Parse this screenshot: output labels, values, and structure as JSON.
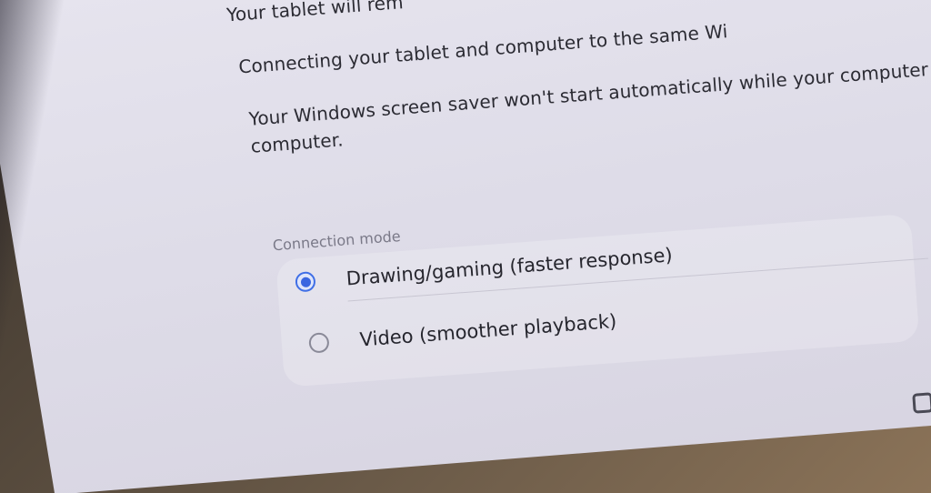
{
  "paragraphs": {
    "p1": "Your tablet will rem",
    "p2": "Connecting your tablet and computer to the same Wi",
    "p3_line1": "Your Windows screen saver won't start automatically while your computer is displayi",
    "p3_line2": "computer."
  },
  "connection_mode": {
    "label": "Connection mode",
    "options": [
      {
        "label": "Drawing/gaming (faster response)",
        "selected": true
      },
      {
        "label": "Video (smoother playback)",
        "selected": false
      }
    ]
  },
  "navigation": {
    "recents_glyph": "|||"
  },
  "colors": {
    "accent": "#3a66e0",
    "screen_bg": "#e2e0ea",
    "text": "#2b2b33",
    "secondary_text": "#7a7988"
  }
}
